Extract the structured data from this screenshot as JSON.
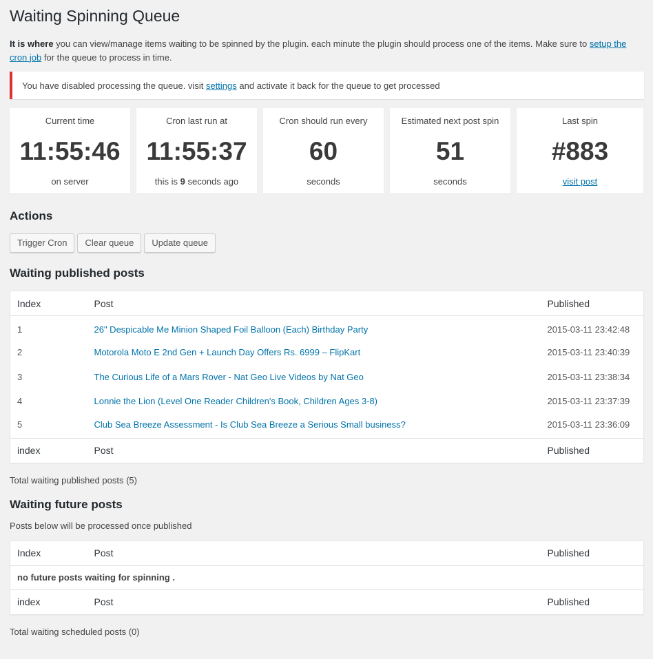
{
  "page": {
    "title": "Waiting Spinning Queue",
    "intro_bold": "It is where",
    "intro_text": " you can view/manage items waiting to be spinned by the plugin. each minute the plugin should process one of the items. Make sure to ",
    "intro_link": "setup the cron job",
    "intro_tail": " for the queue to process in time."
  },
  "notice": {
    "text_before": "You have disabled processing the queue. visit ",
    "link": "settings",
    "text_after": " and activate it back for the queue to get processed",
    "border_color": "#dc3232"
  },
  "stats": [
    {
      "label": "Current time",
      "value": "11:55:46",
      "sub": "on server"
    },
    {
      "label": "Cron last run at",
      "value": "11:55:37",
      "sub_before": "this is ",
      "sub_bold": "9",
      "sub_after": " seconds ago"
    },
    {
      "label": "Cron should run every",
      "value": "60",
      "sub": "seconds"
    },
    {
      "label": "Estimated next post spin",
      "value": "51",
      "sub": "seconds"
    },
    {
      "label": "Last spin",
      "value": "#883",
      "sub_link": "visit post"
    }
  ],
  "actions": {
    "title": "Actions",
    "trigger_cron": "Trigger Cron",
    "clear_queue": "Clear queue",
    "update_queue": "Update queue"
  },
  "published": {
    "title": "Waiting published posts",
    "head": {
      "index": "Index",
      "post": "Post",
      "published": "Published"
    },
    "foot": {
      "index": "index",
      "post": "Post",
      "published": "Published"
    },
    "rows": [
      {
        "index": "1",
        "post": "26\" Despicable Me Minion Shaped Foil Balloon (Each) Birthday Party",
        "published": "2015-03-11 23:42:48"
      },
      {
        "index": "2",
        "post": "Motorola Moto E 2nd Gen + Launch Day Offers Rs. 6999 – FlipKart",
        "published": "2015-03-11 23:40:39"
      },
      {
        "index": "3",
        "post": "The Curious Life of a Mars Rover - Nat Geo Live Videos by Nat Geo",
        "published": "2015-03-11 23:38:34"
      },
      {
        "index": "4",
        "post": "Lonnie the Lion (Level One Reader Children's Book, Children Ages 3-8)",
        "published": "2015-03-11 23:37:39"
      },
      {
        "index": "5",
        "post": "Club Sea Breeze Assessment - Is Club Sea Breeze a Serious Small business?",
        "published": "2015-03-11 23:36:09"
      }
    ],
    "total": "Total waiting published posts (5)"
  },
  "future": {
    "title": "Waiting future posts",
    "desc": "Posts below will be processed once published",
    "head": {
      "index": "Index",
      "post": "Post",
      "published": "Published"
    },
    "foot": {
      "index": "index",
      "post": "Post",
      "published": "Published"
    },
    "empty": "no future posts waiting for spinning .",
    "total": "Total waiting scheduled posts (0)"
  }
}
